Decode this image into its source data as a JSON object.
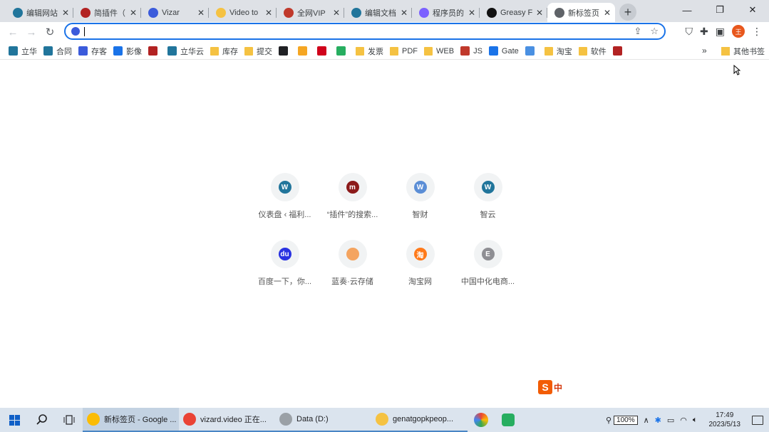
{
  "tabs": [
    {
      "label": "编辑网站",
      "icon": "wordpress-icon",
      "color": "#21759b"
    },
    {
      "label": "简插件（",
      "icon": "app-icon",
      "color": "#b22222"
    },
    {
      "label": "Vizar",
      "icon": "vizard-icon",
      "color": "#3b5bdb"
    },
    {
      "label": "Video to",
      "icon": "video-icon",
      "color": "#f5c242"
    },
    {
      "label": "全网VIP",
      "icon": "vip-icon",
      "color": "#c0392b"
    },
    {
      "label": "编辑文档",
      "icon": "wordpress-icon",
      "color": "#21759b"
    },
    {
      "label": "程序员的",
      "icon": "colorful-icon",
      "color": "#7b61ff"
    },
    {
      "label": "Greasy F",
      "icon": "greasyfork-icon",
      "color": "#111111"
    },
    {
      "label": "新标签页",
      "icon": "chrome-icon",
      "color": "#5f6368",
      "active": true
    }
  ],
  "window": {
    "minimize": "—",
    "restore": "❐",
    "close": "✕"
  },
  "toolbar": {
    "back": "←",
    "forward": "→",
    "reload": "↻",
    "address_value": "",
    "avatar": "王"
  },
  "bookmarks": [
    {
      "label": "立华",
      "kind": "site",
      "color": "#21759b"
    },
    {
      "label": "合同",
      "kind": "site",
      "color": "#21759b"
    },
    {
      "label": "存客",
      "kind": "site",
      "color": "#3b5bdb"
    },
    {
      "label": "影像",
      "kind": "site",
      "color": "#1a73e8"
    },
    {
      "label": "",
      "kind": "site",
      "color": "#b22222"
    },
    {
      "label": "立华云",
      "kind": "site",
      "color": "#21759b"
    },
    {
      "label": "库存",
      "kind": "folder"
    },
    {
      "label": "提交",
      "kind": "folder"
    },
    {
      "label": "",
      "kind": "site",
      "color": "#202124"
    },
    {
      "label": "",
      "kind": "site",
      "color": "#f5a623"
    },
    {
      "label": "",
      "kind": "site",
      "color": "#d0021b"
    },
    {
      "label": "",
      "kind": "site",
      "color": "#27ae60"
    },
    {
      "label": "发票",
      "kind": "folder"
    },
    {
      "label": "PDF",
      "kind": "folder"
    },
    {
      "label": "WEB",
      "kind": "folder"
    },
    {
      "label": "JS",
      "kind": "site",
      "color": "#c0392b"
    },
    {
      "label": "Gate",
      "kind": "site",
      "color": "#1a73e8"
    },
    {
      "label": "",
      "kind": "site",
      "color": "#4a90e2"
    },
    {
      "label": "淘宝",
      "kind": "folder"
    },
    {
      "label": "软件",
      "kind": "folder"
    },
    {
      "label": "",
      "kind": "site",
      "color": "#b22222"
    }
  ],
  "bookmarks_more": "»",
  "other_bookmarks": "其他书签",
  "shortcuts": [
    {
      "name": "仪表盘 ‹ 福利...",
      "letter": "W",
      "color": "#21759b"
    },
    {
      "name": "“插件”的搜索...",
      "letter": "m",
      "color": "#8b1a1a"
    },
    {
      "name": "智财",
      "letter": "W",
      "color": "#5b8ed6"
    },
    {
      "name": "智云",
      "letter": "W",
      "color": "#21759b"
    },
    {
      "name": "百度一下，你...",
      "letter": "du",
      "color": "#2932e1"
    },
    {
      "name": "蓝奏·云存储",
      "letter": "",
      "color": "#f4a460"
    },
    {
      "name": "淘宝网",
      "letter": "淘",
      "color": "#ff7a1a"
    },
    {
      "name": "中国中化电商...",
      "letter": "E",
      "color": "#8e8e93"
    }
  ],
  "ime": {
    "logo": "S",
    "mode": "中"
  },
  "taskbar": {
    "apps": [
      {
        "label": "新标签页 - Google ...",
        "color": "#fbbc04",
        "active": true
      },
      {
        "label": "vizard.video 正在...",
        "color": "#ea4335",
        "active": false
      },
      {
        "label": "Data (D:)",
        "color": "#9aa0a6",
        "active": false
      },
      {
        "label": "genatgopkpeop...",
        "color": "#f5c242",
        "active": false
      }
    ],
    "battery": "100%",
    "time": "17:49",
    "date": "2023/5/13"
  }
}
